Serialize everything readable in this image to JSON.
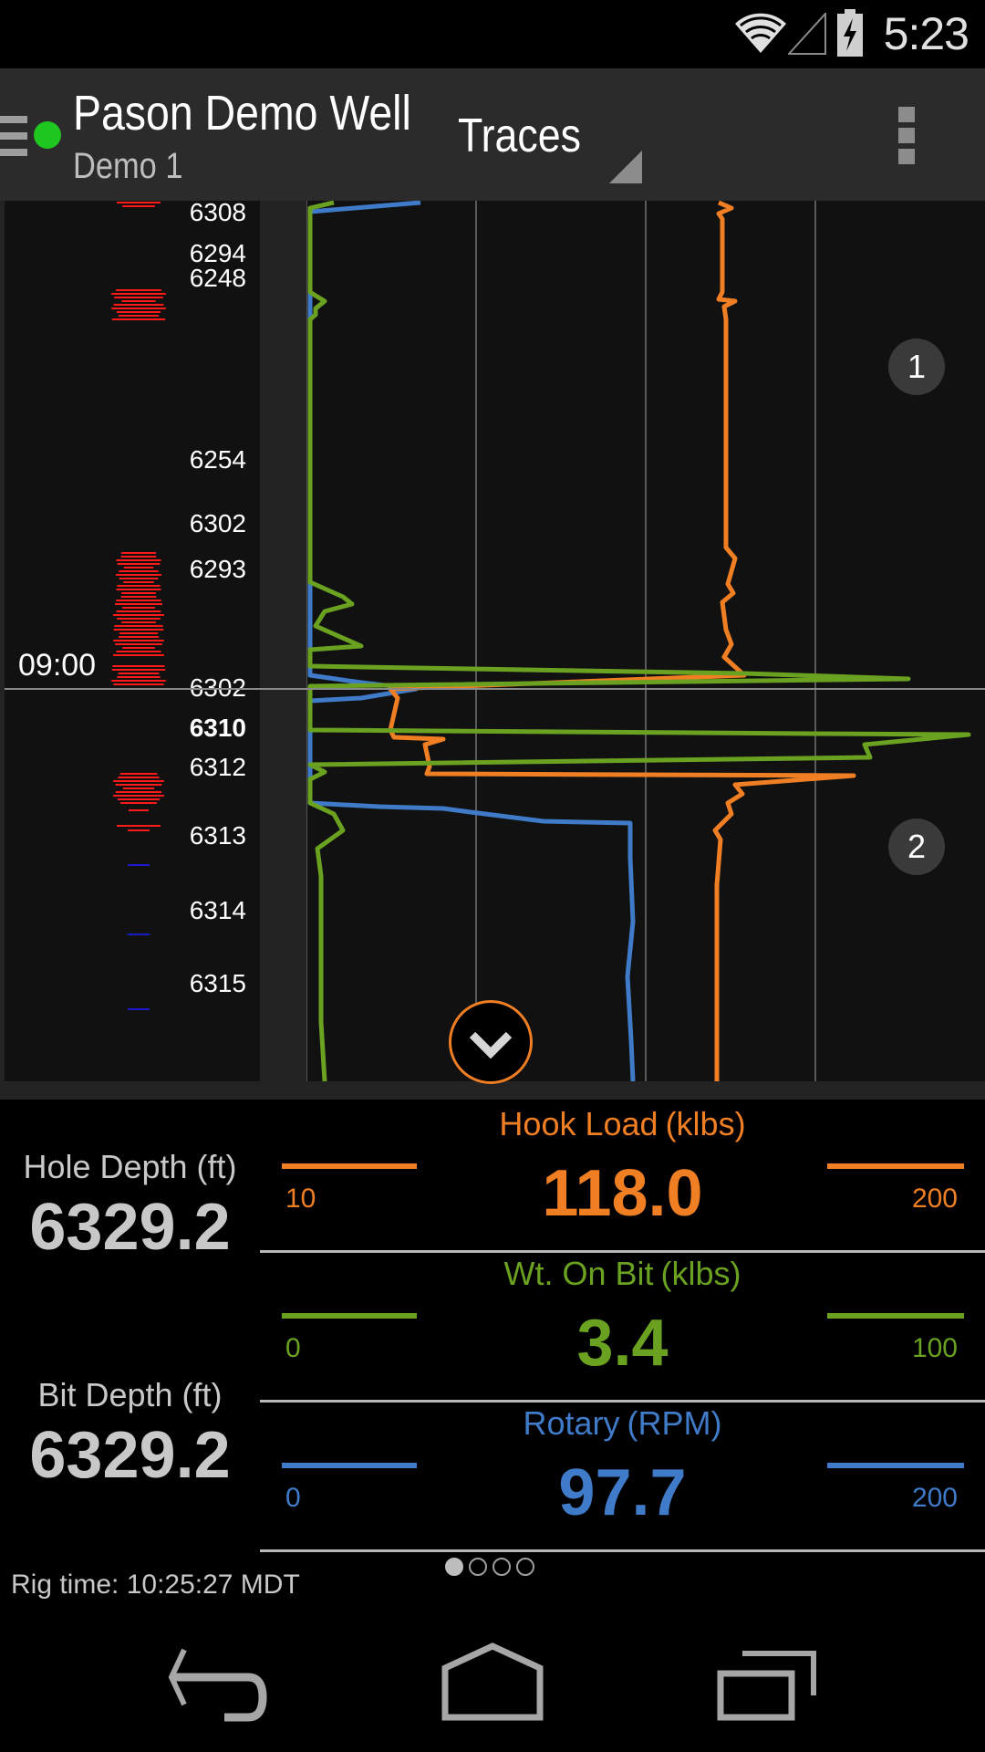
{
  "status_bar": {
    "time": "5:23",
    "icons": [
      "wifi-icon",
      "cell-signal-icon",
      "battery-charging-icon"
    ]
  },
  "action_bar": {
    "well_name": "Pason Demo Well",
    "rig_name": "Demo 1",
    "connection_status": "connected",
    "connection_color": "#1fc61f",
    "view_selector": "Traces",
    "icons": [
      "menu-icon",
      "overflow-menu-icon"
    ]
  },
  "traces": {
    "time_marker": "09:00",
    "depth_labels": [
      {
        "text": "6308",
        "bold": false
      },
      {
        "text": "6294",
        "bold": false
      },
      {
        "text": "6248",
        "bold": false
      },
      {
        "text": "6254",
        "bold": false
      },
      {
        "text": "6302",
        "bold": false
      },
      {
        "text": "6293",
        "bold": false
      },
      {
        "text": "6302",
        "bold": false
      },
      {
        "text": "6310",
        "bold": true
      },
      {
        "text": "6312",
        "bold": false
      },
      {
        "text": "6313",
        "bold": false
      },
      {
        "text": "6314",
        "bold": false
      },
      {
        "text": "6315",
        "bold": false
      }
    ],
    "page_badges": [
      "1",
      "2"
    ],
    "colors": {
      "hook_load": "#f07f24",
      "wob": "#6aa121",
      "rotary": "#3f7bc8",
      "depth_on_bottom": "#ff1a1a",
      "depth_off_bottom": "#1a1acc"
    },
    "scroll_button": "chevron-down-icon"
  },
  "readouts": {
    "hole_depth": {
      "label": "Hole Depth (ft)",
      "value": "6329.2"
    },
    "bit_depth": {
      "label": "Bit Depth (ft)",
      "value": "6329.2"
    }
  },
  "gauges": [
    {
      "title": "Hook Load",
      "unit": "(klbs)",
      "value": "118.0",
      "min": "10",
      "max": "200",
      "color": "#f07f24"
    },
    {
      "title": "Wt. On Bit",
      "unit": "(klbs)",
      "value": "3.4",
      "min": "0",
      "max": "100",
      "color": "#6aa121"
    },
    {
      "title": "Rotary",
      "unit": "(RPM)",
      "value": "97.7",
      "min": "0",
      "max": "200",
      "color": "#3f7bc8"
    }
  ],
  "pager": {
    "pages": 4,
    "current": 1
  },
  "rig_time": "Rig time: 10:25:27 MDT",
  "nav_bar": {
    "buttons": [
      "back-icon",
      "home-icon",
      "recent-apps-icon"
    ]
  }
}
